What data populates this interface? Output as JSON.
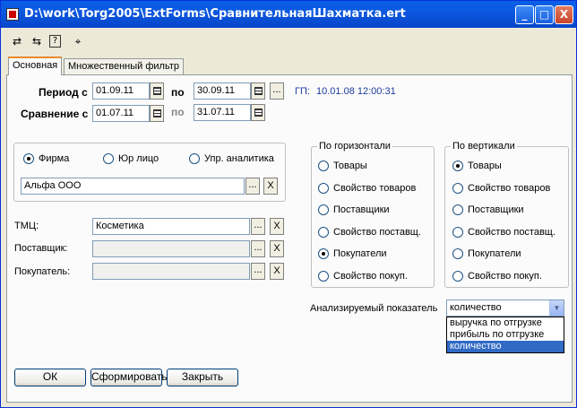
{
  "window": {
    "title": "D:\\work\\Torg2005\\ExtForms\\СравнительнаяШахматка.ert",
    "minimize": "_",
    "maximize": "□",
    "close": "X"
  },
  "toolbar": {
    "tool1": "⇄",
    "tool2": "⇆",
    "tool3": "?",
    "tool4": "⌖"
  },
  "tabs": [
    {
      "label": "Основная"
    },
    {
      "label": "Множественный фильтр"
    }
  ],
  "period": {
    "label": "Период с",
    "from": "01.09.11",
    "to_label": "по",
    "to": "30.09.11",
    "more": "...",
    "gp_label": "ГП:",
    "gp_value": "10.01.08 12:00:31"
  },
  "comparison": {
    "label": "Сравнение с",
    "from": "01.07.11",
    "to_label": "по",
    "to": "31.07.11"
  },
  "entity": {
    "options": [
      "Фирма",
      "Юр лицо",
      "Упр. аналитика"
    ],
    "selected": 0,
    "value": "Альфа ООО",
    "more": "...",
    "clear": "X"
  },
  "filters": {
    "tmc": {
      "label": "ТМЦ:",
      "value": "Косметика"
    },
    "supplier": {
      "label": "Поставщик:",
      "value": ""
    },
    "buyer": {
      "label": "Покупатель:",
      "value": ""
    },
    "more": "...",
    "clear": "X"
  },
  "horizontal": {
    "title": "По горизонтали",
    "options": [
      "Товары",
      "Свойство товаров",
      "Поставщики",
      "Свойство поставщ.",
      "Покупатели",
      "Свойство покуп."
    ],
    "selected": 4
  },
  "vertical": {
    "title": "По вертикали",
    "options": [
      "Товары",
      "Свойство товаров",
      "Поставщики",
      "Свойство поставщ.",
      "Покупатели",
      "Свойство покуп."
    ],
    "selected": 0
  },
  "indicator": {
    "label": "Анализируемый показатель",
    "value": "количество",
    "options": [
      "выручка по отгрузке",
      "прибыль по отгрузке",
      "количество"
    ],
    "selected": 2
  },
  "buttons": {
    "ok": "ОК",
    "build": "Сформировать",
    "close": "Закрыть"
  }
}
